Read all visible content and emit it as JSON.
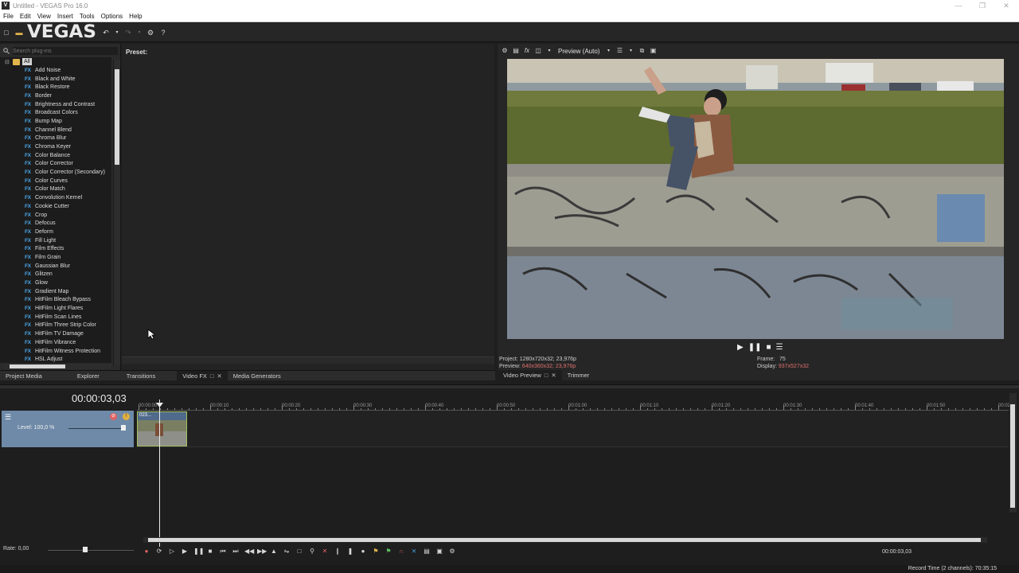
{
  "window": {
    "title": "Untitled - VEGAS Pro 16.0",
    "icon_letter": "V"
  },
  "menu": [
    "File",
    "Edit",
    "View",
    "Insert",
    "Tools",
    "Options",
    "Help"
  ],
  "toolbar": {
    "logo": "VEGAS"
  },
  "plugins": {
    "search_placeholder": "Search plug-ins",
    "root_label": "All",
    "badge": "FX",
    "items": [
      "Add Noise",
      "Black and White",
      "Black Restore",
      "Border",
      "Brightness and Contrast",
      "Broadcast Colors",
      "Bump Map",
      "Channel Blend",
      "Chroma Blur",
      "Chroma Keyer",
      "Color Balance",
      "Color Corrector",
      "Color Corrector (Secondary)",
      "Color Curves",
      "Color Match",
      "Convolution Kernel",
      "Cookie Cutter",
      "Crop",
      "Defocus",
      "Deform",
      "Fill Light",
      "Film Effects",
      "Film Grain",
      "Gaussian Blur",
      "Glitzen",
      "Glow",
      "Gradient Map",
      "HitFilm Bleach Bypass",
      "HitFilm Light Flares",
      "HitFilm Scan Lines",
      "HitFilm Three Strip Color",
      "HitFilm TV Damage",
      "HitFilm Vibrance",
      "HitFilm Witness Protection",
      "HSL Adjust"
    ]
  },
  "preset": {
    "label": "Preset:"
  },
  "panel_tabs": [
    "Project Media",
    "Explorer",
    "Transitions",
    "Video FX",
    "Media Generators"
  ],
  "preview": {
    "quality": "Preview (Auto)",
    "project_label": "Project:",
    "project_value": "1280x720x32; 23,976p",
    "preview_label": "Preview:",
    "preview_value": "640x360x32; 23,976p",
    "frame_label": "Frame:",
    "frame_value": "75",
    "display_label": "Display:",
    "display_value": "937x527x32",
    "tabs": [
      "Video Preview",
      "Trimmer"
    ]
  },
  "timeline": {
    "timecode": "00:00:03,03",
    "ruler": [
      "00:00:00",
      "00:00:10",
      "00:00:20",
      "00:00:30",
      "00:00:40",
      "00:00:50",
      "00:01:00",
      "00:01:10",
      "00:01:20",
      "00:01:30",
      "00:01:40",
      "00:01:50",
      "00:02"
    ],
    "track_level": "Level: 100,0 %",
    "clip_name": "023...",
    "rate": "Rate: 0,00",
    "cursor_time": "00:00:03,03",
    "record_time": "Record Time (2 channels): 70:35:15"
  },
  "colors": {
    "fx_badge": "#4aa6e8",
    "track_header": "#6e8aa8",
    "highlight": "#e07070"
  }
}
